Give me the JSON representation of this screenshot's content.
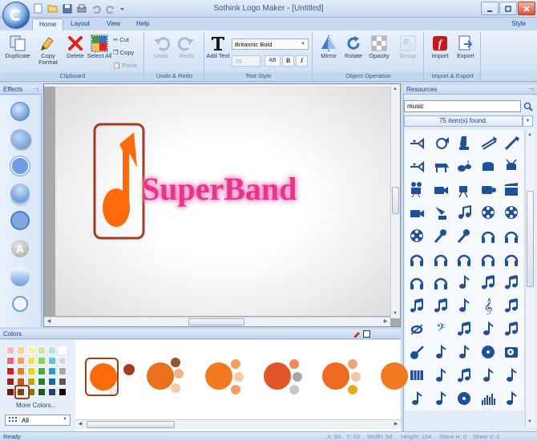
{
  "window": {
    "title": "Sothink Logo Maker - [Untitled]"
  },
  "tabs": [
    {
      "label": "Home",
      "active": true
    },
    {
      "label": "Layout",
      "active": false
    },
    {
      "label": "View",
      "active": false
    },
    {
      "label": "Help",
      "active": false
    }
  ],
  "style_label": "Style",
  "ribbon": {
    "clipboard": {
      "label": "Clipboard",
      "duplicate": "Duplicate",
      "copy_format": "Copy Format",
      "delete": "Delete",
      "select_all": "Select All",
      "cut": "Cut",
      "copy": "Copy",
      "paste": "Paste"
    },
    "undo_redo": {
      "label": "Undo & Redo",
      "undo": "Undo",
      "redo": "Redo"
    },
    "text_style": {
      "label": "Text Style",
      "add_text": "Add Text",
      "font": "Britannic Bold",
      "size": "25",
      "spacing_icon": "AB",
      "bold": "B",
      "italic": "I"
    },
    "object_operation": {
      "label": "Object Operation",
      "mirror": "Mirror",
      "rotate": "Rotate",
      "opacity": "Opacity",
      "group": "Group"
    },
    "import_export": {
      "label": "Import & Export",
      "import": "Import",
      "export": "Export"
    }
  },
  "effects": {
    "title": "Effects",
    "items": [
      "effect-sphere",
      "effect-shadow",
      "effect-flat",
      "effect-drop",
      "effect-ring",
      "effect-letter-a",
      "effect-gloss",
      "effect-outline"
    ],
    "letter": "A"
  },
  "canvas": {
    "logo_text_part1": "Super",
    "logo_text_part2": "Band",
    "logo_text_color": "#e8348c",
    "logo_accent_color": "#ff6a0a",
    "frame_color": "#a23c1a"
  },
  "resources": {
    "title": "Resources",
    "search_value": "music",
    "found_text": "75 item(s) found.",
    "icons": [
      "trumpet-icon",
      "french-horn-icon",
      "tuba-icon",
      "trombone-icon",
      "clarinet-icon",
      "trumpet-icon",
      "grand-piano-icon",
      "drum-kit-icon",
      "drums-icon",
      "snare-drum-icon",
      "film-camera-icon",
      "video-camera-icon",
      "movie-camera-icon",
      "camcorder-icon",
      "clapperboard-icon",
      "video-camera-icon",
      "gramophone-icon",
      "music-notes-icon",
      "film-reel-icon",
      "film-reel-icon",
      "film-reel-icon",
      "microphone-icon",
      "microphone-icon",
      "headphones-icon",
      "headphones-icon",
      "headphones-icon",
      "headphones-icon",
      "headphones-icon",
      "headphones-icon",
      "headphones-icon",
      "headphones-icon",
      "headphones-icon",
      "music-note-icon",
      "beamed-notes-icon",
      "beamed-notes-icon",
      "beamed-notes-icon",
      "beamed-notes-icon",
      "music-note-icon",
      "treble-clef-icon",
      "beamed-notes-icon",
      "whole-note-icon",
      "bass-clef-icon",
      "beamed-notes-icon",
      "music-note-icon",
      "beamed-notes-icon",
      "guitar-icon",
      "music-note-icon",
      "music-note-icon",
      "cd-icon",
      "turntable-icon",
      "accordion-icon",
      "music-note-icon",
      "beamed-notes-icon",
      "music-note-icon",
      "music-note-icon",
      "music-note-icon",
      "music-note-icon",
      "cd-icon",
      "equalizer-icon",
      "music-note-icon"
    ]
  },
  "colors": {
    "title": "Colors",
    "more_colors": "More Colors...",
    "scheme_filter": "All",
    "palette": [
      "#f7b8c8",
      "#f8cfa8",
      "#fbf0a6",
      "#c9e8a2",
      "#b6e1e8",
      "#ffffff",
      "#f0607a",
      "#f6a24e",
      "#f6e04a",
      "#8cd34c",
      "#5ec6da",
      "#d9d9d9",
      "#e01b1b",
      "#f27c16",
      "#f4d300",
      "#49b02c",
      "#1f9fd5",
      "#a6a6a6",
      "#a71b1b",
      "#c5590e",
      "#c7a200",
      "#27812a",
      "#1b64b5",
      "#595959",
      "#6b1b1b",
      "#8a3e0c",
      "#8c7000",
      "#1c5a1e",
      "#1c3f7d",
      "#000000"
    ],
    "schemes": [
      [
        "#ff6a0a",
        "#a23c1a"
      ],
      [
        "#e8711e",
        "#a0522d",
        "#f3b08b",
        "#f7c9a8"
      ],
      [
        "#f27a21",
        "#f6a15a",
        "#f8c9a0",
        "#f29b63"
      ],
      [
        "#e2552b",
        "#f28a5c",
        "#a6a6a6",
        "#c7c7c7"
      ],
      [
        "#f06a22",
        "#f4a07a",
        "#f3c6a6",
        "#e6a91c"
      ],
      [
        "#f07a22"
      ]
    ]
  },
  "status": {
    "ready": "Ready",
    "x": "X: 84",
    "y": "Y: 63",
    "width": "Width: 64",
    "height": "Height: 154",
    "skew_h": "Skew H: 0",
    "skew_v": "Skew V: 0"
  }
}
